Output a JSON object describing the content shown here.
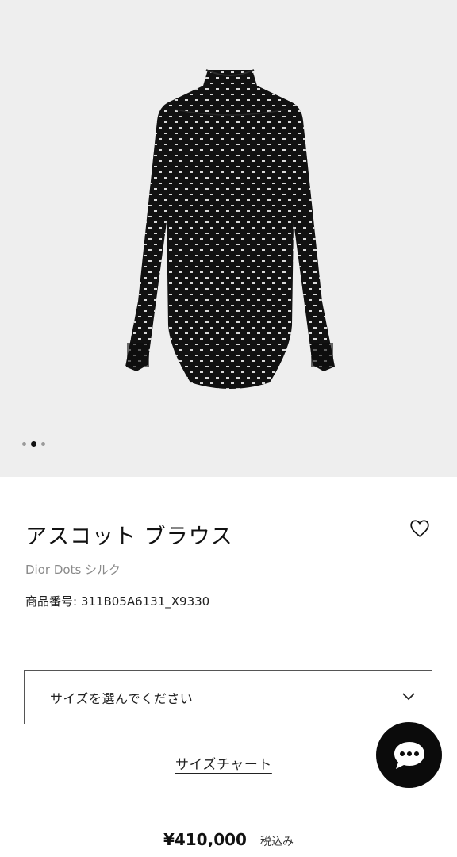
{
  "gallery": {
    "image_alt": "アスコット ブラウス",
    "dot_count": 3,
    "active_dot": 2
  },
  "product": {
    "title": "アスコット ブラウス",
    "subtitle": "Dior Dots シルク",
    "sku": "商品番号: 311B05A6131_X9330"
  },
  "size_select": {
    "placeholder": "サイズを選んでください"
  },
  "size_chart_link": "サイズチャート",
  "price": {
    "amount": "¥410,000",
    "tax_note": "税込み"
  },
  "icons": {
    "wishlist": "heart-icon",
    "dropdown": "chevron-down-icon",
    "chat": "chat-bubble-icon"
  },
  "colors": {
    "gallery_bg": "#eeeeee",
    "garment": "#111111",
    "chat_button": "#0b0b0b"
  }
}
